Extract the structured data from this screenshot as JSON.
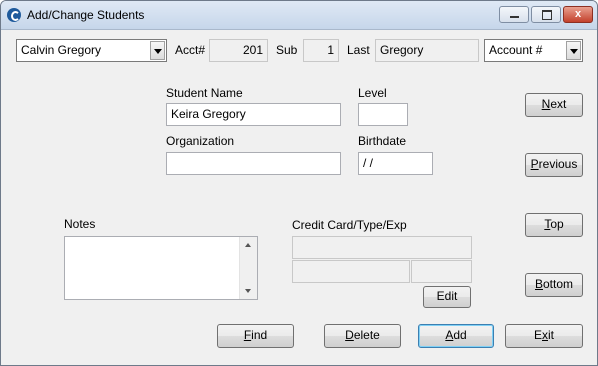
{
  "window": {
    "title": "Add/Change Students",
    "close_glyph": "x"
  },
  "header": {
    "student_select": "Calvin Gregory",
    "acct_label": "Acct#",
    "acct_value": "201",
    "sub_label": "Sub",
    "sub_value": "1",
    "last_label": "Last",
    "last_value": "Gregory",
    "sort_select": "Account #"
  },
  "form": {
    "student_name_label": "Student Name",
    "student_name_value": "Keira Gregory",
    "level_label": "Level",
    "level_value": "",
    "organization_label": "Organization",
    "organization_value": "",
    "birthdate_label": "Birthdate",
    "birthdate_value": " /  /",
    "notes_label": "Notes",
    "credit_label": "Credit Card/Type/Exp",
    "credit_number": "",
    "credit_type": "",
    "credit_exp": ""
  },
  "nav": {
    "next_prefix": "",
    "next_key": "N",
    "next_rest": "ext",
    "previous_prefix": "",
    "previous_key": "P",
    "previous_rest": "revious",
    "top_prefix": "",
    "top_key": "T",
    "top_rest": "op",
    "bottom_prefix": "",
    "bottom_key": "B",
    "bottom_rest": "ottom"
  },
  "actions": {
    "edit_label": "Edit",
    "find_prefix": "",
    "find_key": "F",
    "find_rest": "ind",
    "delete_prefix": "",
    "delete_key": "D",
    "delete_rest": "elete",
    "add_prefix": "",
    "add_key": "A",
    "add_rest": "dd",
    "exit_prefix": "E",
    "exit_key": "x",
    "exit_rest": "it"
  }
}
